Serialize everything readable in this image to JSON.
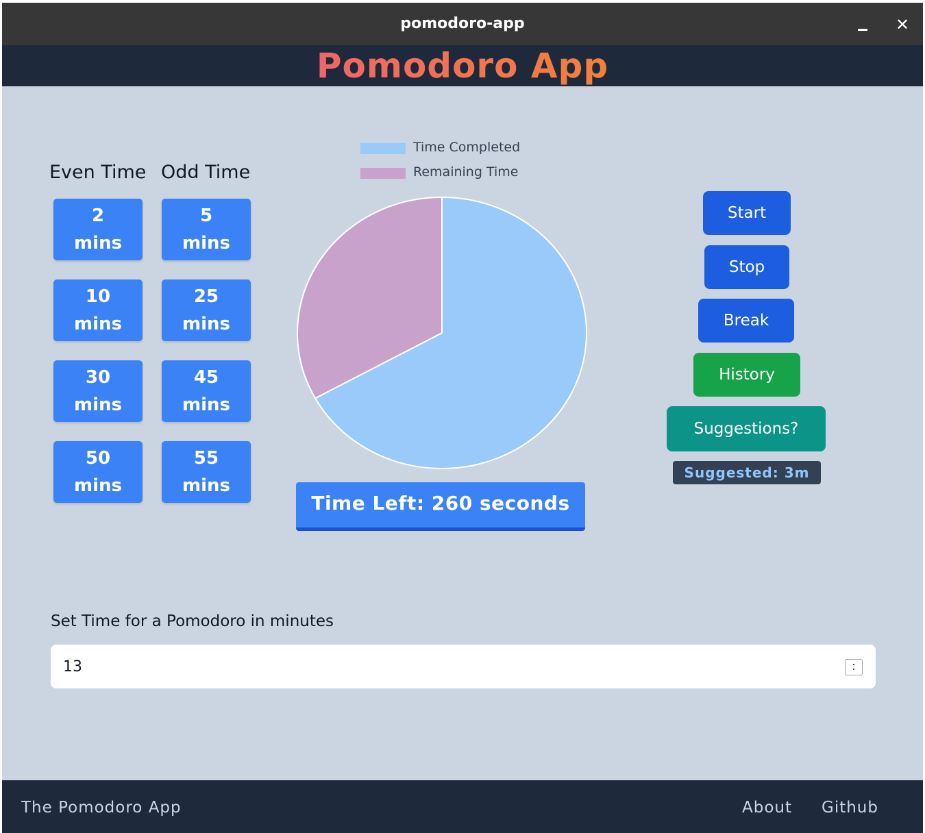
{
  "window": {
    "title": "pomodoro-app",
    "minimize_label": "minimize",
    "close_glyph": "✕"
  },
  "header": {
    "title": "Pomodoro App",
    "gradient_colors": [
      "#ec4899",
      "#f59e0b"
    ]
  },
  "presets": {
    "even_heading": "Even Time",
    "odd_heading": "Odd Time",
    "even": [
      {
        "value": "2",
        "unit": "mins"
      },
      {
        "value": "10",
        "unit": "mins"
      },
      {
        "value": "30",
        "unit": "mins"
      },
      {
        "value": "50",
        "unit": "mins"
      }
    ],
    "odd": [
      {
        "value": "5",
        "unit": "mins"
      },
      {
        "value": "25",
        "unit": "mins"
      },
      {
        "value": "45",
        "unit": "mins"
      },
      {
        "value": "55",
        "unit": "mins"
      }
    ],
    "color": "#3b82f6"
  },
  "chart_data": {
    "type": "pie",
    "legend": [
      "Time Completed",
      "Remaining Time"
    ],
    "values": [
      67,
      33
    ],
    "colors": [
      "#99caf9",
      "#c8a2cb"
    ],
    "legend_position": "top"
  },
  "timer": {
    "time_left_label": "Time Left: 260 seconds"
  },
  "actions": {
    "start": "Start",
    "stop": "Stop",
    "break": "Break",
    "history": "History",
    "suggestions": "Suggestions?",
    "suggested": "Suggested: 3m",
    "colors": {
      "primary": "#1d5ee0",
      "history": "#16a34a",
      "suggestions": "#0d9488"
    }
  },
  "form": {
    "label": "Set Time for a Pomodoro in minutes",
    "value": "13"
  },
  "footer": {
    "brand": "The Pomodoro App",
    "about": "About",
    "github": "Github"
  }
}
